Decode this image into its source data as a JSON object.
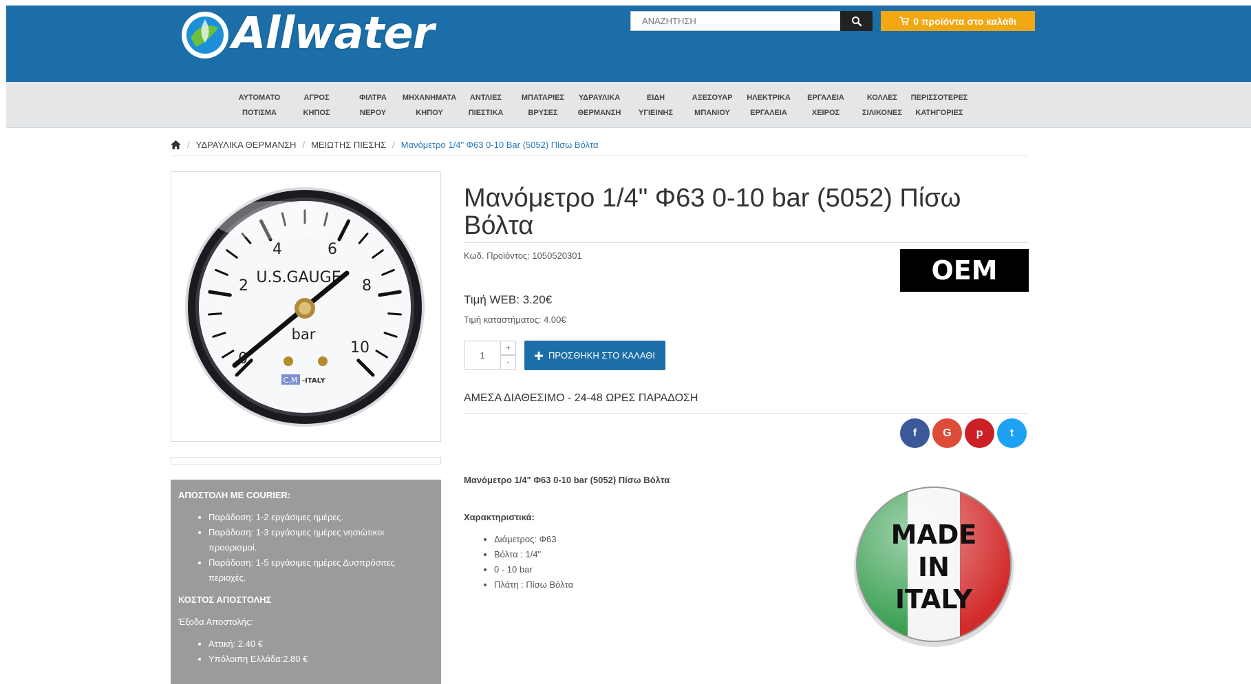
{
  "header": {
    "logo_text": "Allwater",
    "search_placeholder": "ΑΝΑΖΗΤΗΣΗ",
    "cart_label": "0 προϊόντα στο καλάθι",
    "colors": {
      "header_bg": "#1b6ea8",
      "cart_bg": "#f3a712"
    }
  },
  "nav": {
    "items": [
      {
        "line1": "ΑΥΤΟΜΑΤΟ",
        "line2": "ΠΟΤΙΣΜΑ"
      },
      {
        "line1": "ΑΓΡΟΣ",
        "line2": "ΚΗΠΟΣ"
      },
      {
        "line1": "ΦΙΛΤΡΑ",
        "line2": "ΝΕΡΟΥ"
      },
      {
        "line1": "ΜΗΧΑΝΗΜΑΤΑ",
        "line2": "ΚΗΠΟΥ"
      },
      {
        "line1": "ΑΝΤΛΙΕΣ",
        "line2": "ΠΙΕΣΤΙΚΑ"
      },
      {
        "line1": "ΜΠΑΤΑΡΙΕΣ",
        "line2": "ΒΡΥΣΕΣ"
      },
      {
        "line1": "ΥΔΡΑΥΛΙΚΑ",
        "line2": "ΘΕΡΜΑΝΣΗ"
      },
      {
        "line1": "ΕΙΔΗ",
        "line2": "ΥΓΙΕΙΝΗΣ"
      },
      {
        "line1": "ΑΞΕΣΟΥΑΡ",
        "line2": "ΜΠΑΝΙΟΥ"
      },
      {
        "line1": "ΗΛΕΚΤΡΙΚΑ",
        "line2": "ΕΡΓΑΛΕΙΑ"
      },
      {
        "line1": "ΕΡΓΑΛΕΙΑ",
        "line2": "ΧΕΙΡΟΣ"
      },
      {
        "line1": "ΚΟΛΛΕΣ",
        "line2": "ΣΙΛΙΚΟΝΕΣ"
      },
      {
        "line1": "ΠΕΡΙΣΣΟΤΕΡΕΣ",
        "line2": "ΚΑΤΗΓΟΡΙΕΣ"
      }
    ]
  },
  "breadcrumb": {
    "items": [
      "ΥΔΡΑΥΛΙΚΑ ΘΕΡΜΑΝΣΗ",
      "ΜΕΙΩΤΗΣ ΠΙΕΣΗΣ",
      "Μανόμετρο 1/4\" Φ63 0-10 Bar (5052) Πίσω Βόλτα"
    ]
  },
  "product": {
    "title": "Μανόμετρο 1/4\" Φ63 0-10 bar (5052) Πίσω Βόλτα",
    "code": "Κωδ. Προϊόντος: 1050520301",
    "brand_badge": "OEM",
    "price_web": "Τιμή WEB: 3.20€",
    "price_store": "Τιμή καταστήματος: 4.00€",
    "quantity": "1",
    "qty_plus": "+",
    "qty_minus": "-",
    "add_to_cart": "ΠΡΟΣΘΗΚΗ ΣΤΟ ΚΑΛΑΘΙ",
    "availability": "ΑΜΕΣΑ ΔΙΑΘΕΣΙΜΟ - 24-48 ΩΡΕΣ ΠΑΡΑΔΟΣΗ",
    "gauge": {
      "brand": "U.S.GAUGE",
      "unit": "bar",
      "maker": "C.M",
      "origin": "-ITALY",
      "ticks": [
        "0",
        "2",
        "4",
        "6",
        "8",
        "10"
      ]
    }
  },
  "social": {
    "facebook": "f",
    "google": "G",
    "pinterest": "p",
    "twitter": "t",
    "colors": {
      "facebook": "#3b5998",
      "google": "#dd4b39",
      "pinterest": "#cb2027",
      "twitter": "#1da1f2"
    }
  },
  "description": {
    "title": "Μανόμετρο 1/4\" Φ63 0-10 bar (5052) Πίσω Βόλτα",
    "features_title": "Χαρακτηριστικά:",
    "features": [
      "Διάμετρος: Φ63",
      "Βόλτα : 1/4\"",
      "0 - 10 bar",
      "Πλάτη : Πίσω Βόλτα"
    ]
  },
  "made_in": {
    "line1": "MADE",
    "line2": "IN",
    "line3": "ITALY"
  },
  "shipping": {
    "courier_title": "ΑΠΟΣΤΟΛΗ ΜΕ COURIER:",
    "courier_items": [
      "Παράδοση: 1-2 εργάσιμες ημέρες.",
      "Παράδοση: 1-3 εργάσιμες ημέρες νησιώτικοι προορισμοί.",
      "Παράδοση: 1-5 εργάσιμες ημέρες Δυσπρόσιτες περιοχές."
    ],
    "cost_title": "ΚΟΣΤΟΣ ΑΠΟΣΤΟΛΗΣ",
    "cost_subtitle": "Έξοδα Αποστολής:",
    "cost_items": [
      "Αττική: 2.40 €",
      "Υπόλοιπη Ελλάδα:2.80 €"
    ]
  }
}
